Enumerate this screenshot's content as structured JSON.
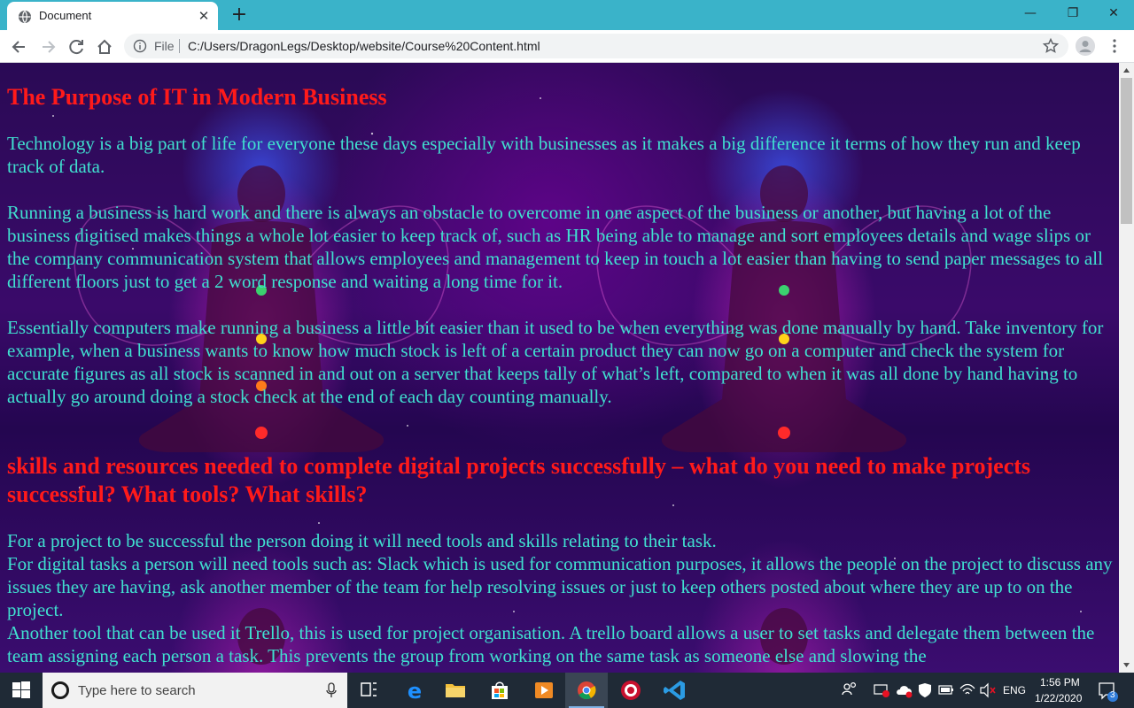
{
  "browser": {
    "tab_title": "Document",
    "tab_close": "✕",
    "new_tab": "+",
    "window_controls": {
      "minimize": "—",
      "restore": "❐",
      "close": "✕"
    },
    "address": {
      "scheme_label": "File",
      "url": "C:/Users/DragonLegs/Desktop/website/Course%20Content.html"
    }
  },
  "page": {
    "heading1": "The Purpose of IT in Modern Business",
    "paragraphs": {
      "p1": "Technology is a big part of life for everyone these days especially with businesses as it makes a big difference it terms of how they run and keep track of data.",
      "p2": "Running a business is hard work and there is always an obstacle to overcome in one aspect of the business or another, but having a lot of the business digitised makes things a whole lot easier to keep track of, such as HR being able to manage and sort employees details and wage slips or the company communication system that allows employees and management to keep in touch a lot easier than having to send paper messages to all different floors just to get a 2 word response and waiting a long time for it.",
      "p3": "Essentially computers make running a business a little bit easier than it used to be when everything was done manually by hand. Take inventory for example, when a business wants to know how much stock is left of a certain product they can now go on a computer and check the system for accurate figures as all stock is scanned in and out on a server that keeps tally of what’s left, compared to when it was all done by hand having to actually go around doing a stock check at the end of each day counting manually."
    },
    "heading2": "skills and resources needed to complete digital projects successfully – what do you need to make projects successful? What tools? What skills?",
    "lines": {
      "l1": "For a project to be successful the person doing it will need tools and skills relating to their task.",
      "l2": "For digital tasks a person will need tools such as: Slack which is used for communication purposes, it allows the people on the project to discuss any issues they are having, ask another member of the team for help resolving issues or just to keep others posted about where they are up to on the project.",
      "l3": "Another tool that can be used it Trello, this is used for project organisation. A trello board allows a user to set tasks and delegate them between the team assigning each person a task. This prevents the group from working on the same task as someone else and slowing the"
    },
    "colors": {
      "heading": "#ff1a1a",
      "body_text": "#40e0d0"
    }
  },
  "taskbar": {
    "search_placeholder": "Type here to search",
    "language": "ENG",
    "time": "1:56 PM",
    "date": "1/22/2020",
    "notification_count": "3"
  }
}
